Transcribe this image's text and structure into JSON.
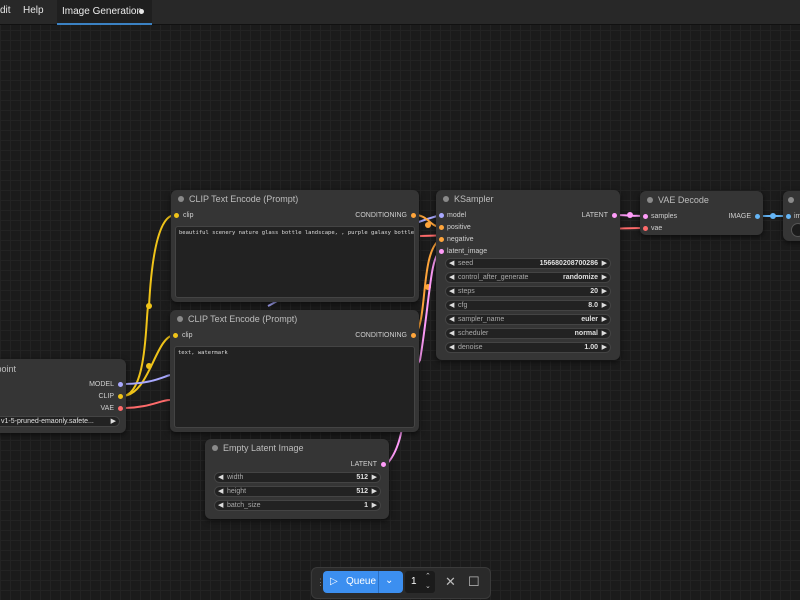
{
  "menu": {
    "edit_label": "dit",
    "help_label": "Help"
  },
  "tab": {
    "title": "Image Generation"
  },
  "colors": {
    "clip": "#f0c419",
    "model": "#a9a9ff",
    "vae": "#ff6b6b",
    "conditioning": "#ffa53b",
    "latent": "#ff9cf9",
    "image": "#64b5f6"
  },
  "nodes": {
    "clip_pos": {
      "title": "CLIP Text Encode (Prompt)",
      "input": "clip",
      "output": "CONDITIONING",
      "text": "beautiful scenery nature glass bottle landscape, , purple galaxy bottle,"
    },
    "clip_neg": {
      "title": "CLIP Text Encode (Prompt)",
      "input": "clip",
      "output": "CONDITIONING",
      "text": "text, watermark"
    },
    "checkpoint": {
      "title": "xpoint",
      "outputs": [
        "MODEL",
        "CLIP",
        "VAE"
      ],
      "ckpt_name": "v1-5-pruned-emaonly.safete..."
    },
    "ksampler": {
      "title": "KSampler",
      "inputs": [
        "model",
        "positive",
        "negative",
        "latent_image"
      ],
      "output": "LATENT",
      "widgets": [
        {
          "label": "seed",
          "value": "156680208700286"
        },
        {
          "label": "control_after_generate",
          "value": "randomize"
        },
        {
          "label": "steps",
          "value": "20"
        },
        {
          "label": "cfg",
          "value": "8.0"
        },
        {
          "label": "sampler_name",
          "value": "euler"
        },
        {
          "label": "scheduler",
          "value": "normal"
        },
        {
          "label": "denoise",
          "value": "1.00"
        }
      ]
    },
    "vae_decode": {
      "title": "VAE Decode",
      "inputs": [
        "samples",
        "vae"
      ],
      "output": "IMAGE"
    },
    "save_image": {
      "input": "im"
    },
    "empty_latent": {
      "title": "Empty Latent Image",
      "output": "LATENT",
      "widgets": [
        {
          "label": "width",
          "value": "512"
        },
        {
          "label": "height",
          "value": "512"
        },
        {
          "label": "batch_size",
          "value": "1"
        }
      ]
    }
  },
  "queue": {
    "label": "Queue",
    "count": "1"
  }
}
